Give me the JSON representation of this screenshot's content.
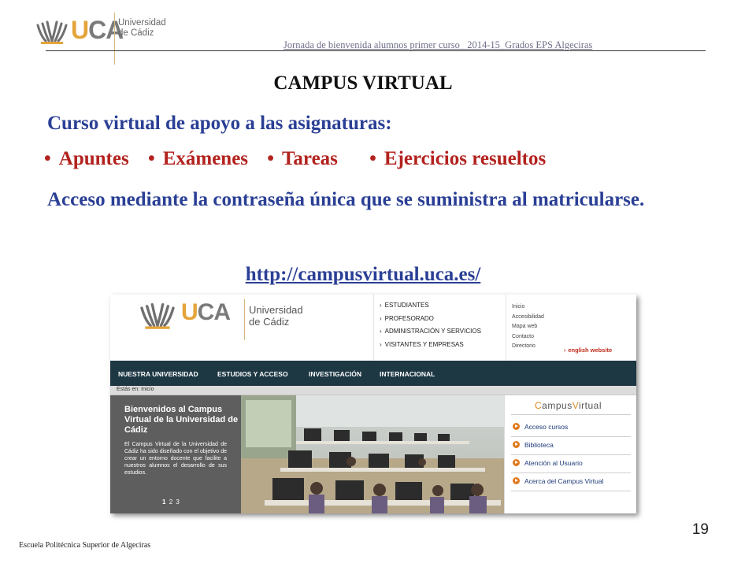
{
  "header": {
    "logo_brand": "UCA",
    "logo_name_line1": "Universidad",
    "logo_name_line2": "de Cádiz",
    "course_title": "Jornada de bienvenida alumnos primer curso_ 2014-15_Grados EPS Algeciras"
  },
  "slide": {
    "title": "CAMPUS VIRTUAL",
    "subtitle": "Curso virtual de apoyo a las asignaturas:",
    "bullet_symbol": "•",
    "bullets": [
      "Apuntes",
      "Exámenes",
      "Tareas",
      "Ejercicios resueltos"
    ],
    "access_text": "Acceso mediante la contraseña única que se suministra al matricularse.",
    "link": "http://campusvirtual.uca.es/",
    "footer": "Escuela Politécnica Superior de Algeciras",
    "page_number": "19"
  },
  "site": {
    "logo_brand": "UCA",
    "logo_name_line1": "Universidad",
    "logo_name_line2": "de Cádiz",
    "arrow_symbol": "›",
    "audience_links": [
      "ESTUDIANTES",
      "PROFESORADO",
      "ADMINISTRACIÓN Y SERVICIOS",
      "VISITANTES Y EMPRESAS"
    ],
    "quick_links": [
      "Inicio",
      "Accesibilidad",
      "Mapa web",
      "Contacto",
      "Directorio"
    ],
    "english_link": "english website",
    "nav": [
      "NUESTRA UNIVERSIDAD",
      "ESTUDIOS Y ACCESO",
      "INVESTIGACIÓN",
      "INTERNACIONAL"
    ],
    "breadcrumb": "Estás en: Inicio",
    "hero_title": "Bienvenidos al Campus Virtual de la Universidad de Cádiz",
    "hero_text": "El Campus Virtual de la Universidad de Cádiz ha sido diseñado con el objetivo de crear un entorno docente que facilite a nuestros alumnos el desarrollo de sus estudios.",
    "hero_pages": [
      "1",
      "2",
      "3"
    ],
    "panel_title_c": "C",
    "panel_title_mid": "ampus",
    "panel_title_v": "V",
    "panel_title_end": "irtual",
    "panel_links": [
      "Acceso cursos",
      "Biblioteca",
      "Atención al Usuario",
      "Acerca del Campus Virtual"
    ]
  },
  "colors": {
    "title_blue": "#2a3f95",
    "bullet_red": "#b3221e",
    "nav_bar": "#1d3743",
    "panel_accent": "#e07a1d"
  }
}
